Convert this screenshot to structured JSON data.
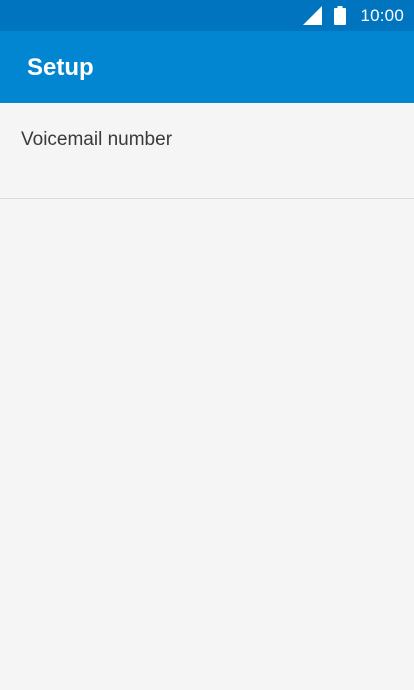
{
  "status_bar": {
    "time": "10:00",
    "icons": [
      "signal-icon",
      "battery-icon"
    ],
    "background": "#0074bf"
  },
  "app_bar": {
    "title": "Setup",
    "background": "#0286d1"
  },
  "settings_list": {
    "items": [
      {
        "label": "Voicemail number"
      }
    ]
  },
  "colors": {
    "page_background": "#f5f5f5",
    "divider": "#d9d9d9",
    "text_primary": "#3a3a3a"
  }
}
